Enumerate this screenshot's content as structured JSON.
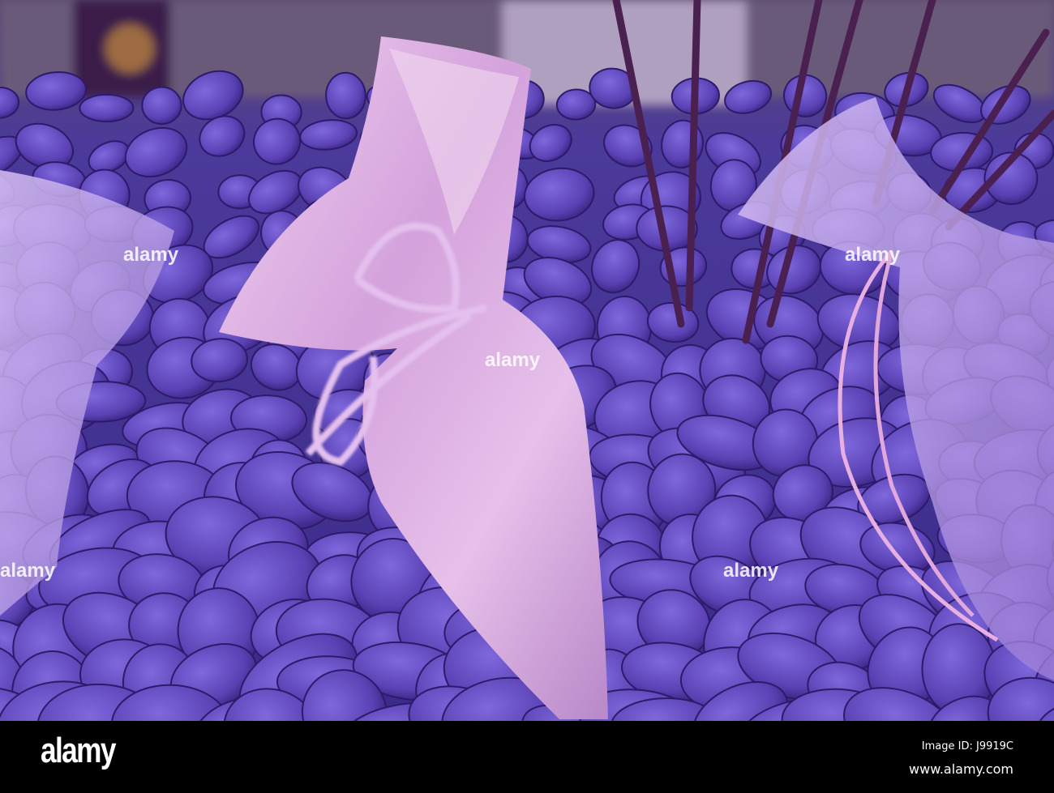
{
  "footer": {
    "logo": "alamy",
    "image_id": "Image ID: J9919C",
    "url": "www.alamy.com"
  },
  "watermark": {
    "text": "alamy",
    "small_text": "a"
  },
  "colors": {
    "rock": "#6a4fc8",
    "satin": "#d9a8e0",
    "organza": "#c8a8ea",
    "stick": "#4a2a5a"
  }
}
